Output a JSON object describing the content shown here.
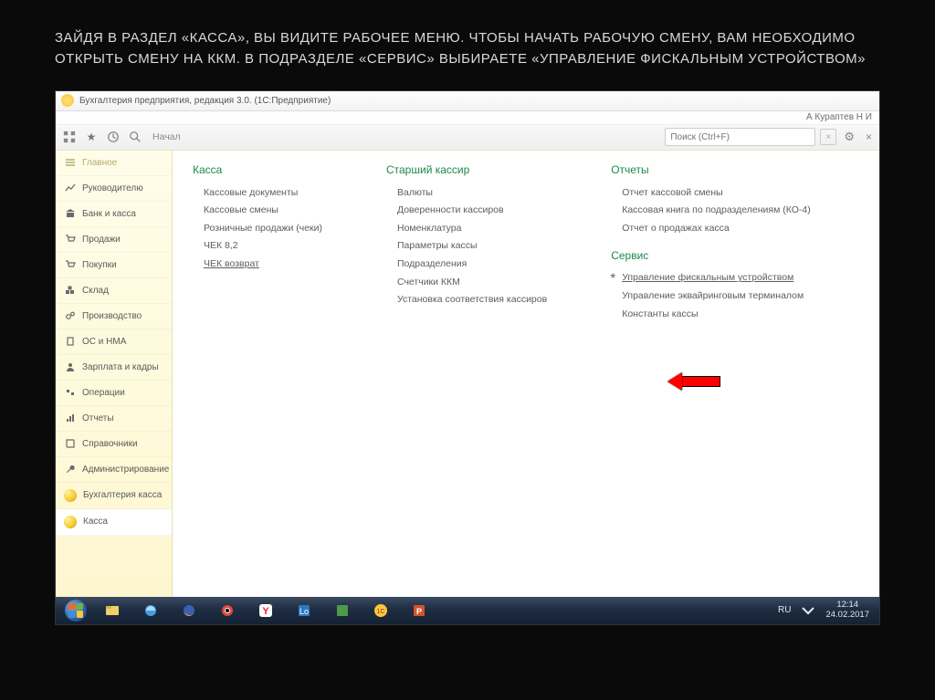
{
  "slide_title": "ЗАЙДЯ В РАЗДЕЛ «КАССА», ВЫ ВИДИТЕ РАБОЧЕЕ МЕНЮ. ЧТОБЫ НАЧАТЬ РАБОЧУЮ СМЕНУ, ВАМ НЕОБХОДИМО ОТКРЫТЬ СМЕНУ НА ККМ. В ПОДРАЗДЕЛЕ «СЕРВИС» ВЫБИРАЕТЕ «УПРАВЛЕНИЕ ФИСКАЛЬНЫМ УСТРОЙСТВОМ»",
  "window_title": "Бухгалтерия предприятия, редакция 3.0. (1С:Предприятие)",
  "user_name": "А Кураптев Н И",
  "breadcrumb": "Начал",
  "search_placeholder": "Поиск (Ctrl+F)",
  "sidebar": [
    {
      "label": "Главное",
      "icon": "menu"
    },
    {
      "label": "Руководителю",
      "icon": "chart"
    },
    {
      "label": "Банк и касса",
      "icon": "bank"
    },
    {
      "label": "Продажи",
      "icon": "cart"
    },
    {
      "label": "Покупки",
      "icon": "cart"
    },
    {
      "label": "Склад",
      "icon": "boxes"
    },
    {
      "label": "Производство",
      "icon": "gears"
    },
    {
      "label": "ОС и НМА",
      "icon": "building"
    },
    {
      "label": "Зарплата и кадры",
      "icon": "person"
    },
    {
      "label": "Операции",
      "icon": "ops"
    },
    {
      "label": "Отчеты",
      "icon": "report"
    },
    {
      "label": "Справочники",
      "icon": "book"
    },
    {
      "label": "Администрирование",
      "icon": "wrench"
    },
    {
      "label": "Бухгалтерия касса",
      "icon": "ball"
    },
    {
      "label": "Касса",
      "icon": "ball"
    }
  ],
  "columns": {
    "kassa": {
      "head": "Касса",
      "items": [
        "Кассовые документы",
        "Кассовые смены",
        "Розничные продажи (чеки)",
        "ЧЕК 8,2",
        "ЧЕК возврат"
      ]
    },
    "senior": {
      "head": "Старший кассир",
      "items": [
        "Валюты",
        "Доверенности кассиров",
        "Номенклатура",
        "Параметры кассы",
        "Подразделения",
        "Счетчики ККМ",
        "Установка соответствия кассиров"
      ]
    },
    "reports": {
      "head": "Отчеты",
      "items": [
        "Отчет кассовой смены",
        "Кассовая книга по подразделениям (КО-4)",
        "Отчет о продажах касса"
      ]
    },
    "service": {
      "head": "Сервис",
      "items": [
        "Управление фискальным устройством",
        "Управление эквайринговым терминалом",
        "Константы кассы"
      ]
    }
  },
  "taskbar": {
    "lang": "RU",
    "time": "12:14",
    "date": "24.02.2017"
  }
}
